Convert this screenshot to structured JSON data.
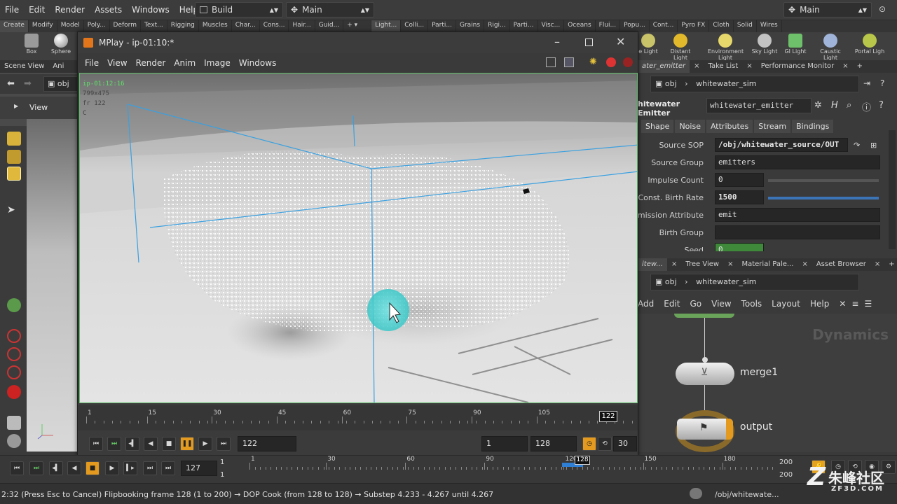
{
  "menubar": {
    "items": [
      "File",
      "Edit",
      "Render",
      "Assets",
      "Windows",
      "Help"
    ],
    "desktop": "Build",
    "context": "Main",
    "right_context": "Main"
  },
  "shelf_tabs_left": [
    "Create",
    "Modify",
    "Model",
    "Poly...",
    "Deform",
    "Text...",
    "Rigging",
    "Muscles",
    "Char...",
    "Cons...",
    "Hair...",
    "Guid..."
  ],
  "shelf_tabs_right": [
    "Light...",
    "Colli...",
    "Parti...",
    "Grains",
    "Rigi...",
    "Parti...",
    "Visc...",
    "Oceans",
    "Flui...",
    "Popu...",
    "Cont...",
    "Pyro FX",
    "Cloth",
    "Solid",
    "Wires"
  ],
  "shelf_tools_left": [
    {
      "label": "Box",
      "color": "#9a9a9a"
    },
    {
      "label": "Sphere",
      "color": "#b9b9b9"
    }
  ],
  "shelf_tools_right": [
    {
      "label": "e Light",
      "color": "#c9c36a"
    },
    {
      "label": "Distant Light",
      "color": "#e3b92c"
    },
    {
      "label": "Environment Light",
      "color": "#e7d86c"
    },
    {
      "label": "Sky Light",
      "color": "#c2c2c2"
    },
    {
      "label": "GI Light",
      "color": "#6fc06b"
    },
    {
      "label": "Caustic Light",
      "color": "#9fb4d8"
    },
    {
      "label": "Portal Ligh",
      "color": "#b8c74a"
    }
  ],
  "left_pane": {
    "tabs": [
      "Scene View",
      "Ani"
    ],
    "path": "obj",
    "view_label": "View"
  },
  "mplay": {
    "title": "MPlay - ip-01:10:*",
    "menu": [
      "File",
      "View",
      "Render",
      "Anim",
      "Image",
      "Windows"
    ],
    "overlay": {
      "name": "ip-01:12:16",
      "resolution": "799x475",
      "frame": "fr 122",
      "channel": "C"
    },
    "timeline": {
      "start": 1,
      "end": 128,
      "current": 122,
      "ticks": [
        1,
        15,
        30,
        45,
        60,
        75,
        90,
        105
      ]
    },
    "controls": {
      "frame_field": "122",
      "range_start": "1",
      "range_end": "128",
      "fps": "30"
    }
  },
  "right_pane": {
    "tabs_top": [
      "ater_emitter",
      "Take List",
      "Performance Monitor"
    ],
    "path_obj": "obj",
    "path_node": "whitewater_sim",
    "node_type": "hitewater Emitter",
    "node_name": "whitewater_emitter",
    "param_tabs": [
      "Shape",
      "Noise",
      "Attributes",
      "Stream",
      "Bindings"
    ],
    "params": [
      {
        "label": "Source SOP",
        "value": "/obj/whitewater_source/OUT"
      },
      {
        "label": "Source Group",
        "value": "emitters"
      },
      {
        "label": "Impulse Count",
        "value": "0"
      },
      {
        "label": "Const. Birth Rate",
        "value": "1500"
      },
      {
        "label": "Emission Attribute",
        "value": "emit"
      },
      {
        "label": "Birth Group",
        "value": ""
      },
      {
        "label": "Seed",
        "value": "0"
      }
    ],
    "tabs_bottom": [
      "itew...",
      "Tree View",
      "Material Pale...",
      "Asset Browser"
    ],
    "net_path_obj": "obj",
    "net_path_node": "whitewater_sim",
    "net_menu": [
      "Add",
      "Edit",
      "Go",
      "View",
      "Tools",
      "Layout",
      "Help"
    ],
    "net_context_label": "Dynamics",
    "nodes": [
      "merge1",
      "output"
    ]
  },
  "main_timeline": {
    "current_frame": "127",
    "start_field": "1",
    "start_field2": "1",
    "ticks": [
      1,
      30,
      60,
      90,
      120,
      150,
      180
    ],
    "marker": "128",
    "end_field": "200",
    "end_field2": "200"
  },
  "status": {
    "text": "2:32 (Press Esc to Cancel) Flipbooking frame 128 (1 to 200) → DOP Cook (from 128 to 128) → Substep 4.233 - 4.267 until 4.267",
    "path": "/obj/whitewate...",
    "watermark": "朱峰社区",
    "watermark_url": "ZF3D.COM"
  }
}
